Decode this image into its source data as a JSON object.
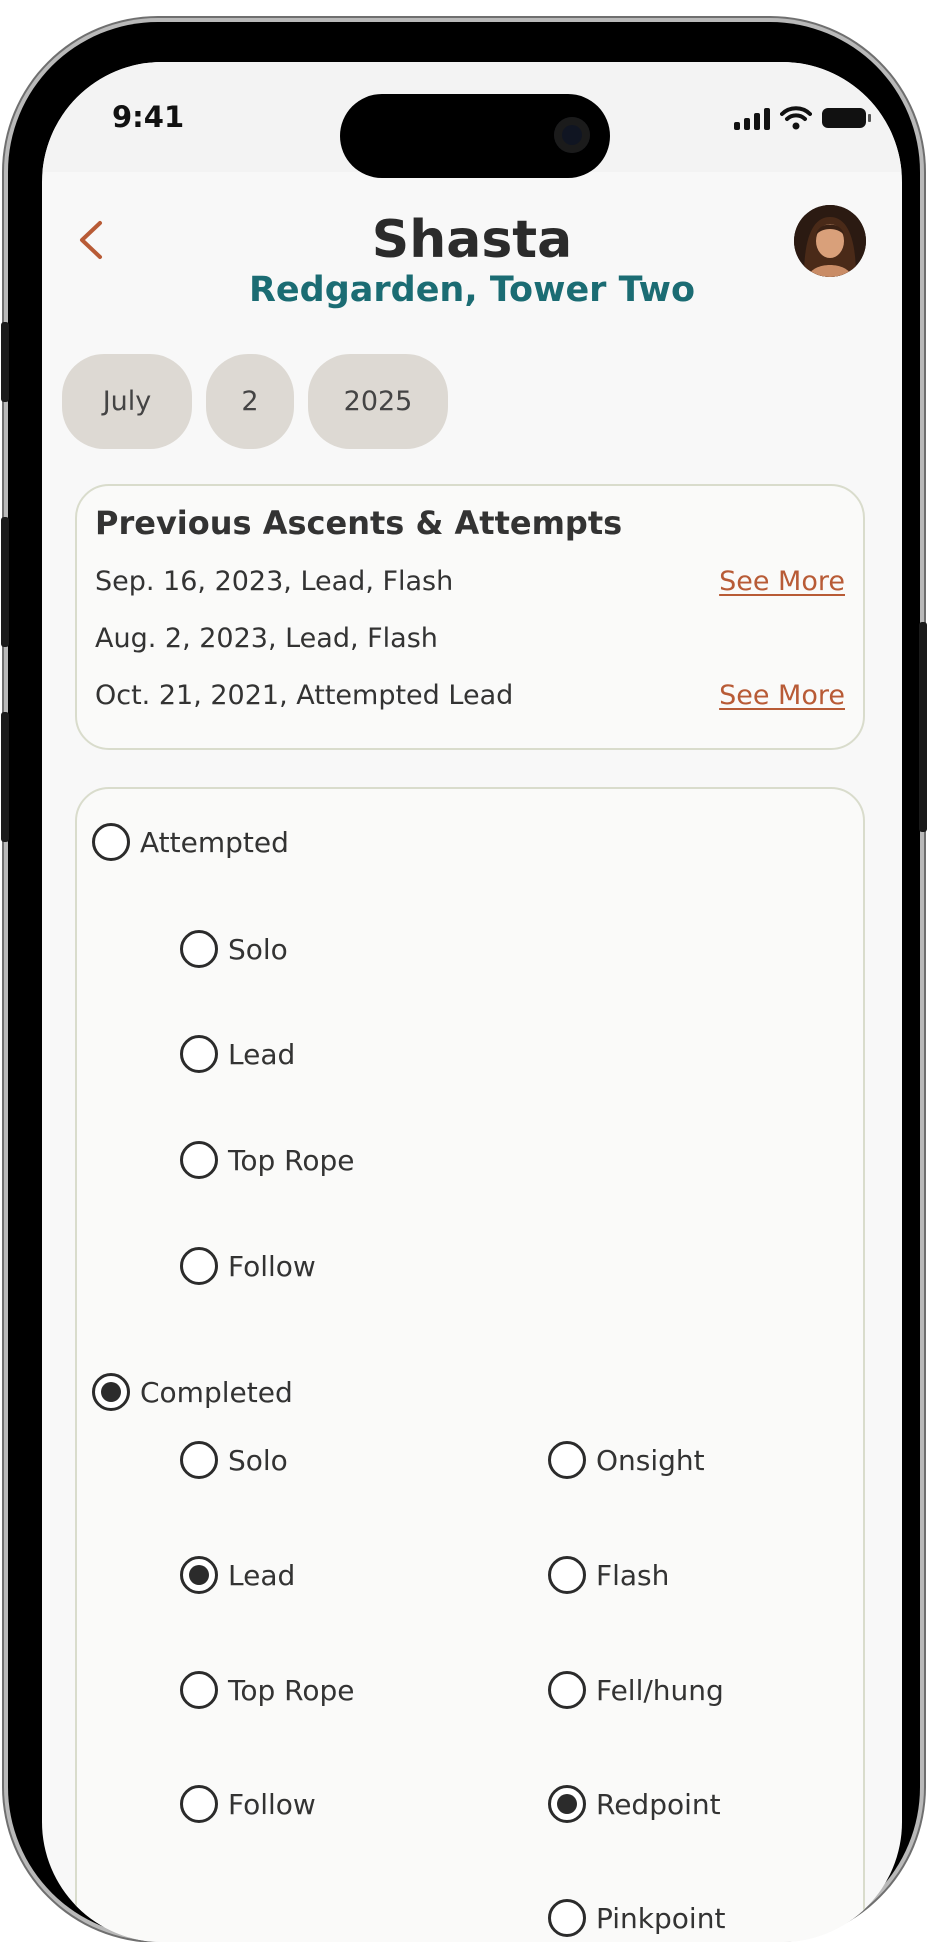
{
  "status_bar": {
    "time": "9:41"
  },
  "header": {
    "back_icon": "chevron-left-icon",
    "title": "Shasta",
    "subtitle": "Redgarden, Tower Two",
    "avatar": "profile-photo-avatar"
  },
  "date": {
    "month": "July",
    "day": "2",
    "year": "2025"
  },
  "history": {
    "title": "Previous Ascents & Attempts",
    "entries": [
      {
        "text": "Sep. 16, 2023, Lead, Flash",
        "link": "See More"
      },
      {
        "text": "Aug. 2, 2023, Lead, Flash",
        "link": ""
      },
      {
        "text": "Oct. 21, 2021, Attempted Lead",
        "link": "See More"
      }
    ]
  },
  "form": {
    "attempted": {
      "label": "Attempted",
      "selected": false,
      "styles": [
        {
          "label": "Solo",
          "selected": false
        },
        {
          "label": "Lead",
          "selected": false
        },
        {
          "label": "Top Rope",
          "selected": false
        },
        {
          "label": "Follow",
          "selected": false
        }
      ]
    },
    "completed": {
      "label": "Completed",
      "selected": true,
      "styles": [
        {
          "label": "Solo",
          "selected": false
        },
        {
          "label": "Lead",
          "selected": true
        },
        {
          "label": "Top Rope",
          "selected": false
        },
        {
          "label": "Follow",
          "selected": false
        }
      ],
      "results": [
        {
          "label": "Onsight",
          "selected": false
        },
        {
          "label": "Flash",
          "selected": false
        },
        {
          "label": "Fell/hung",
          "selected": false
        },
        {
          "label": "Redpoint",
          "selected": true
        },
        {
          "label": "Pinkpoint",
          "selected": false
        }
      ]
    }
  },
  "colors": {
    "accent": "#b85b36",
    "teal": "#1b6c73",
    "pill": "#ddd9d3",
    "card_border": "#d9dccc"
  }
}
